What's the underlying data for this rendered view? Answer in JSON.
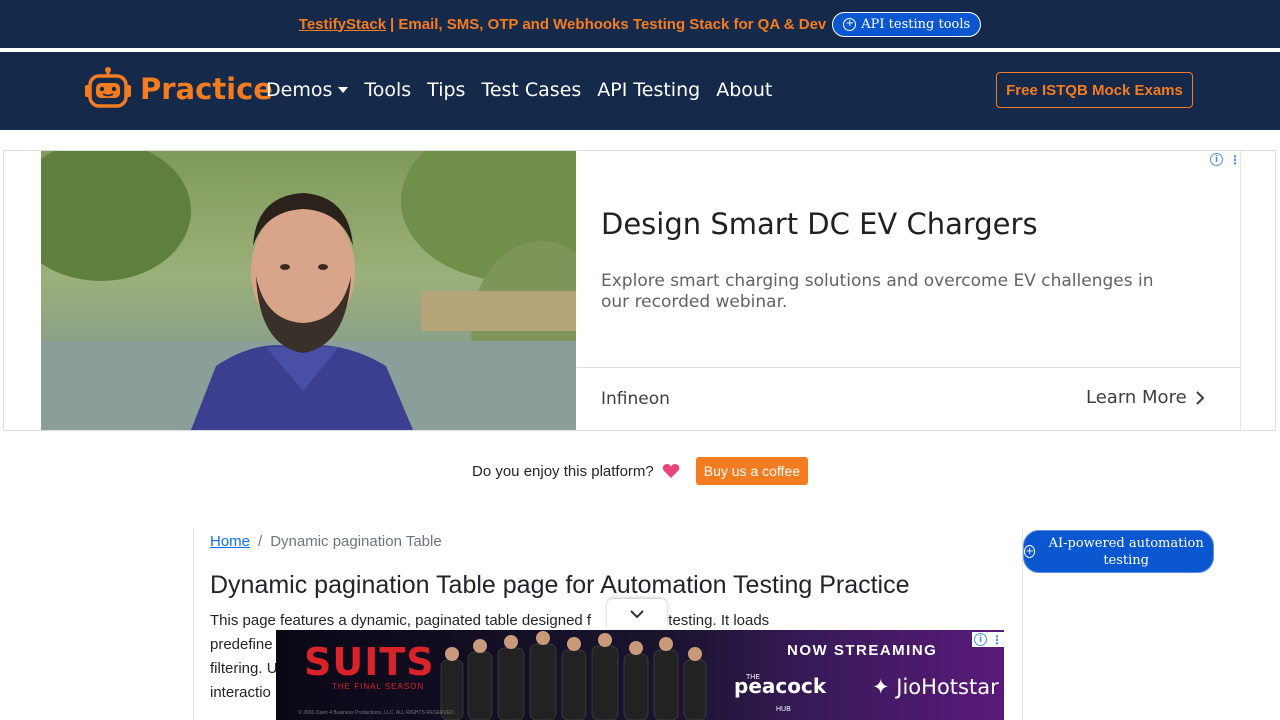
{
  "promo": {
    "brand": "TestifyStack",
    "text": "| Email, SMS, OTP and Webhooks Testing Stack for QA & Dev",
    "pill_label": "API testing tools"
  },
  "navbar": {
    "logo_text": "Practice",
    "links": [
      "Demos",
      "Tools",
      "Tips",
      "Test Cases",
      "API Testing",
      "About"
    ],
    "cta_label": "Free ISTQB Mock Exams"
  },
  "ad": {
    "headline": "Design Smart DC EV Chargers",
    "description": "Explore smart charging solutions and overcome EV challenges in our recorded webinar.",
    "advertiser": "Infineon",
    "cta": "Learn More"
  },
  "coffee": {
    "text": "Do you enjoy this platform?",
    "button": "Buy us a coffee"
  },
  "breadcrumb": {
    "home": "Home",
    "separator": "/",
    "current": "Dynamic pagination Table"
  },
  "main": {
    "title": "Dynamic pagination Table page for Automation Testing Practice",
    "intro_line1_a": "This page features a dynamic, paginated table designed f",
    "intro_line1_b": "mation testing. It loads",
    "intro_line2": "predefine",
    "intro_line3": "filtering. U",
    "intro_line4": "interactio"
  },
  "side_badge": "AI-powered automation testing",
  "anchor_ad": {
    "brand": "SUITS",
    "brand_sub": "THE FINAL SEASON",
    "streaming": "NOW STREAMING",
    "peacock": "peacock",
    "peacock_the": "THE",
    "peacock_hub": "HUB",
    "jio": "JioHotstar",
    "legal": "© 2016 Open 4 Business Productions, LLC. ALL RIGHTS RESERVED."
  },
  "colors": {
    "navy": "#15294a",
    "orange": "#f47c20",
    "link_blue": "#0d6efd",
    "badge_blue": "#0b57d0"
  },
  "icons": {
    "logo": "robot-icon",
    "ad_info": "info-icon",
    "ad_menu": "kebab-icon",
    "heart": "heart-icon",
    "collapse": "chevron-down-icon",
    "learn_more": "chevron-right-icon"
  }
}
